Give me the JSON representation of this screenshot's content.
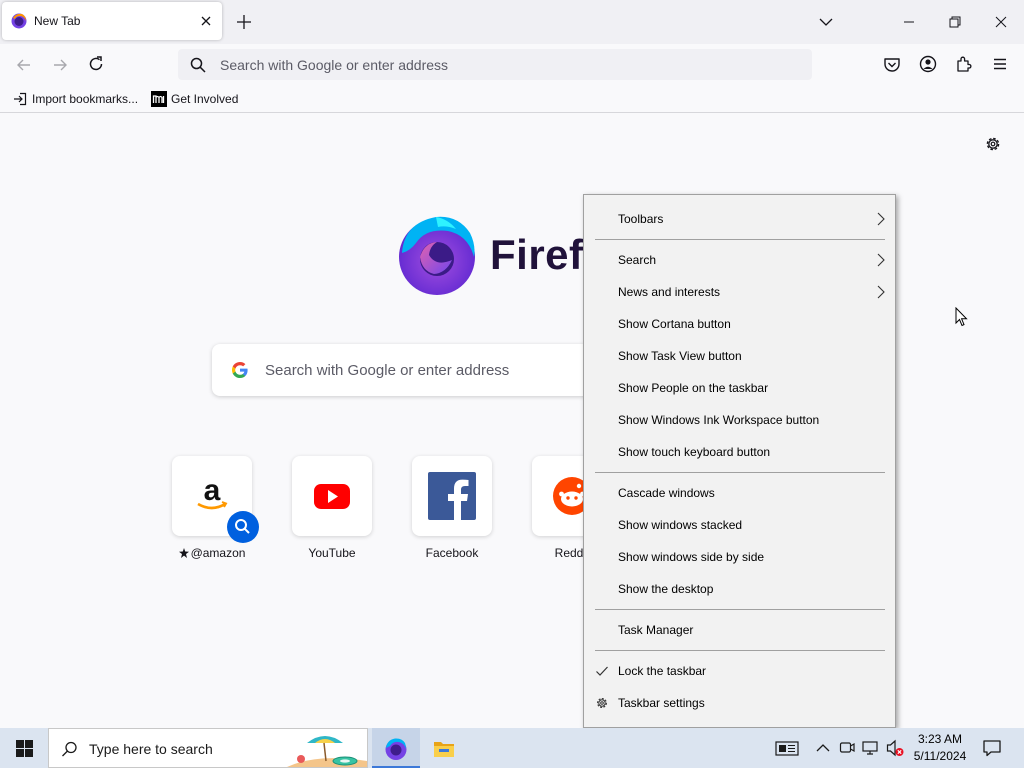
{
  "browser": {
    "tab": {
      "title": "New Tab"
    },
    "urlbar": {
      "placeholder": "Search with Google or enter address"
    },
    "bookmarks": [
      {
        "label": "Import bookmarks..."
      },
      {
        "label": "Get Involved"
      }
    ]
  },
  "newtab": {
    "wordmark": "Firefox",
    "search_placeholder": "Search with Google or enter address",
    "top_sites": [
      {
        "label": "@amazon"
      },
      {
        "label": "YouTube"
      },
      {
        "label": "Facebook"
      },
      {
        "label": "Reddit"
      }
    ]
  },
  "context_menu": {
    "items": [
      {
        "label": "Toolbars",
        "submenu": true
      },
      {
        "label": "Search",
        "submenu": true
      },
      {
        "label": "News and interests",
        "submenu": true
      },
      {
        "label": "Show Cortana button"
      },
      {
        "label": "Show Task View button"
      },
      {
        "label": "Show People on the taskbar"
      },
      {
        "label": "Show Windows Ink Workspace button"
      },
      {
        "label": "Show touch keyboard button"
      },
      {
        "label": "Cascade windows"
      },
      {
        "label": "Show windows stacked"
      },
      {
        "label": "Show windows side by side"
      },
      {
        "label": "Show the desktop"
      },
      {
        "label": "Task Manager"
      },
      {
        "label": "Lock the taskbar",
        "checked": true
      },
      {
        "label": "Taskbar settings",
        "icon": "gear-icon"
      }
    ]
  },
  "taskbar": {
    "search_placeholder": "Type here to search",
    "clock": {
      "time": "3:23 AM",
      "date": "5/11/2024"
    }
  },
  "colors": {
    "accent": "#0060df",
    "taskbar_bg": "#dbe4f0",
    "menu_bg": "#f2f2f2"
  }
}
